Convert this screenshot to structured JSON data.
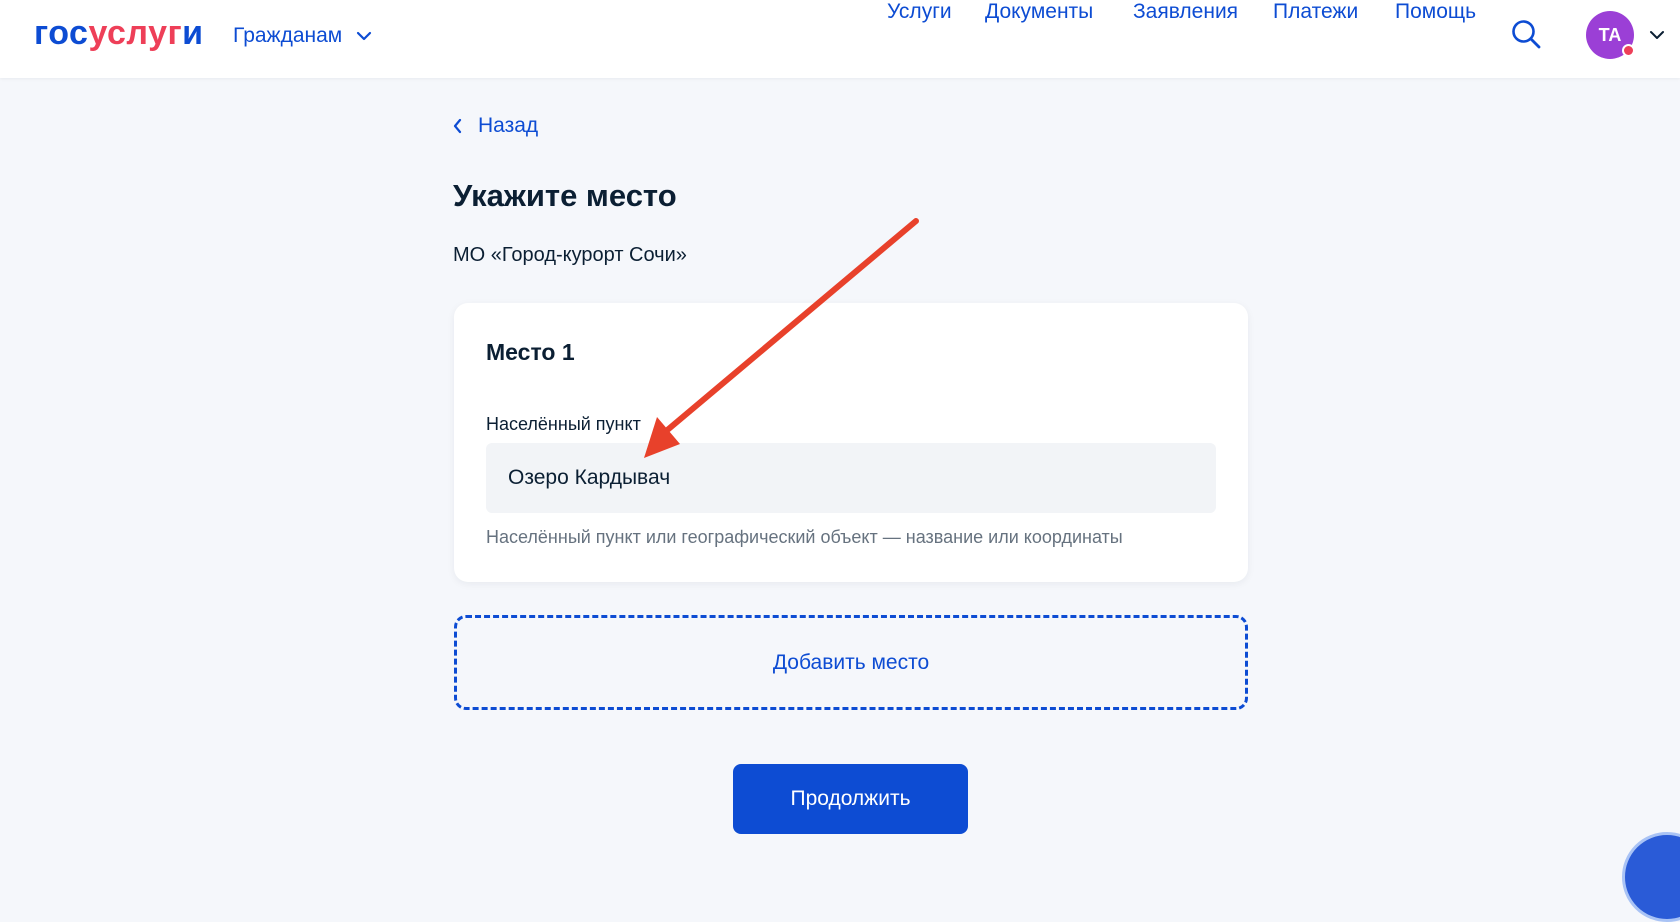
{
  "header": {
    "logo_part1": "гос",
    "logo_part2": "услуг",
    "logo_part3": "и",
    "citizens_label": "Гражданам",
    "nav": [
      {
        "label": "Услуги"
      },
      {
        "label": "Документы"
      },
      {
        "label": "Заявления"
      },
      {
        "label": "Платежи"
      },
      {
        "label": "Помощь"
      }
    ],
    "avatar_initials": "ТА"
  },
  "colors": {
    "brand_blue": "#0d4cd3",
    "brand_red": "#ee3f58",
    "avatar": "#9b3fd6",
    "annotation_arrow": "#e8412b",
    "background": "#f5f7fb"
  },
  "icons": {
    "chevron_down": "chevron-down-icon",
    "search": "search-icon",
    "back": "chevron-left-icon",
    "arrow": "annotation-arrow"
  },
  "main": {
    "back_label": "Назад",
    "title": "Укажите место",
    "subtitle": "МО «Город-курорт Сочи»",
    "place_card": {
      "title": "Место 1",
      "field_label": "Населённый пункт",
      "field_value": "Озеро Кардывач",
      "field_hint": "Населённый пункт или географический объект — название или координаты"
    },
    "add_place_label": "Добавить место",
    "continue_label": "Продолжить"
  }
}
